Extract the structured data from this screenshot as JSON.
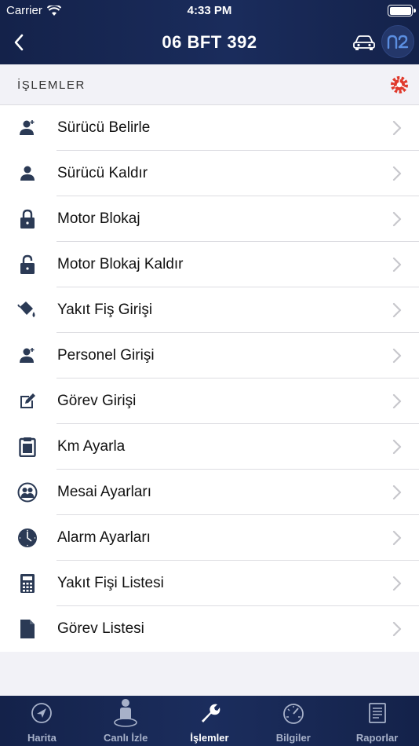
{
  "status": {
    "carrier": "Carrier",
    "time": "4:33 PM"
  },
  "nav": {
    "title": "06 BFT 392",
    "logo_text": "n2"
  },
  "section": {
    "title": "İŞLEMLER"
  },
  "colors": {
    "navy": "#14224a",
    "accent_red": "#e0392b",
    "icon_dark": "#2b3a55"
  },
  "items": [
    {
      "label": "Sürücü Belirle",
      "icon": "person-add-icon"
    },
    {
      "label": "Sürücü Kaldır",
      "icon": "person-icon"
    },
    {
      "label": "Motor Blokaj",
      "icon": "lock-icon"
    },
    {
      "label": "Motor Blokaj Kaldır",
      "icon": "unlock-icon"
    },
    {
      "label": "Yakıt Fiş Girişi",
      "icon": "fuel-can-icon"
    },
    {
      "label": "Personel Girişi",
      "icon": "person-add-icon"
    },
    {
      "label": "Görev Girişi",
      "icon": "edit-icon"
    },
    {
      "label": "Km Ayarla",
      "icon": "clipboard-icon"
    },
    {
      "label": "Mesai Ayarları",
      "icon": "group-icon"
    },
    {
      "label": "Alarm Ayarları",
      "icon": "clock-icon"
    },
    {
      "label": "Yakıt Fişi Listesi",
      "icon": "calculator-icon"
    },
    {
      "label": "Görev Listesi",
      "icon": "document-icon"
    }
  ],
  "tabs": [
    {
      "label": "Harita",
      "icon": "compass-icon",
      "active": false
    },
    {
      "label": "Canlı İzle",
      "icon": "live-person-icon",
      "active": false
    },
    {
      "label": "İşlemler",
      "icon": "wrench-icon",
      "active": true
    },
    {
      "label": "Bilgiler",
      "icon": "gauge-icon",
      "active": false
    },
    {
      "label": "Raporlar",
      "icon": "report-icon",
      "active": false
    }
  ]
}
